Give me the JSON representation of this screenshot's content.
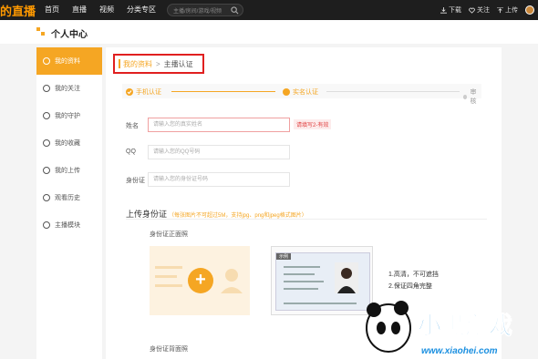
{
  "topbar": {
    "logo": "的直播",
    "nav": [
      "首页",
      "直播",
      "视频",
      "分类专区"
    ],
    "search_placeholder": "主播/房间/游戏/视频",
    "download": "下载",
    "follow": "关注",
    "upload": "上传"
  },
  "page_title": "个人中心",
  "sidebar": {
    "items": [
      {
        "label": "我的资料",
        "icon": "profile-icon",
        "active": true
      },
      {
        "label": "我的关注",
        "icon": "follow-icon"
      },
      {
        "label": "我的守护",
        "icon": "guard-icon"
      },
      {
        "label": "我的收藏",
        "icon": "favorite-icon"
      },
      {
        "label": "我的上传",
        "icon": "upload-icon"
      },
      {
        "label": "观看历史",
        "icon": "history-icon"
      },
      {
        "label": "主播模块",
        "icon": "anchor-icon"
      }
    ]
  },
  "breadcrumb": {
    "parent": "我的资料",
    "separator": ">",
    "current": "主播认证"
  },
  "steps": [
    {
      "label": "手机认证",
      "state": "done"
    },
    {
      "label": "实名认证",
      "state": "current"
    },
    {
      "label": "审核",
      "state": "pending"
    }
  ],
  "form": {
    "name_label": "姓名",
    "name_placeholder": "请输入您的真实姓名",
    "name_error": "请填写2-有效",
    "qq_label": "QQ",
    "qq_placeholder": "请输入您的QQ号码",
    "id_label": "身份证",
    "id_placeholder": "请输入您的身份证号码"
  },
  "upload_section": {
    "title": "上传身份证",
    "note": "（每张图片不可超过5M，支持jpg、png和jpeg格式图片）",
    "front_label": "身份证正面照",
    "back_label": "身份证背面照",
    "sample_tag": "示例",
    "tips": [
      "1.高清，不可遮挡",
      "2.保证四角完整"
    ]
  },
  "watermark": {
    "text": "小黑游戏",
    "url": "www.xiaohei.com"
  },
  "colors": {
    "accent": "#f5a623",
    "error": "#e02020",
    "topbar": "#1e1e1e"
  }
}
